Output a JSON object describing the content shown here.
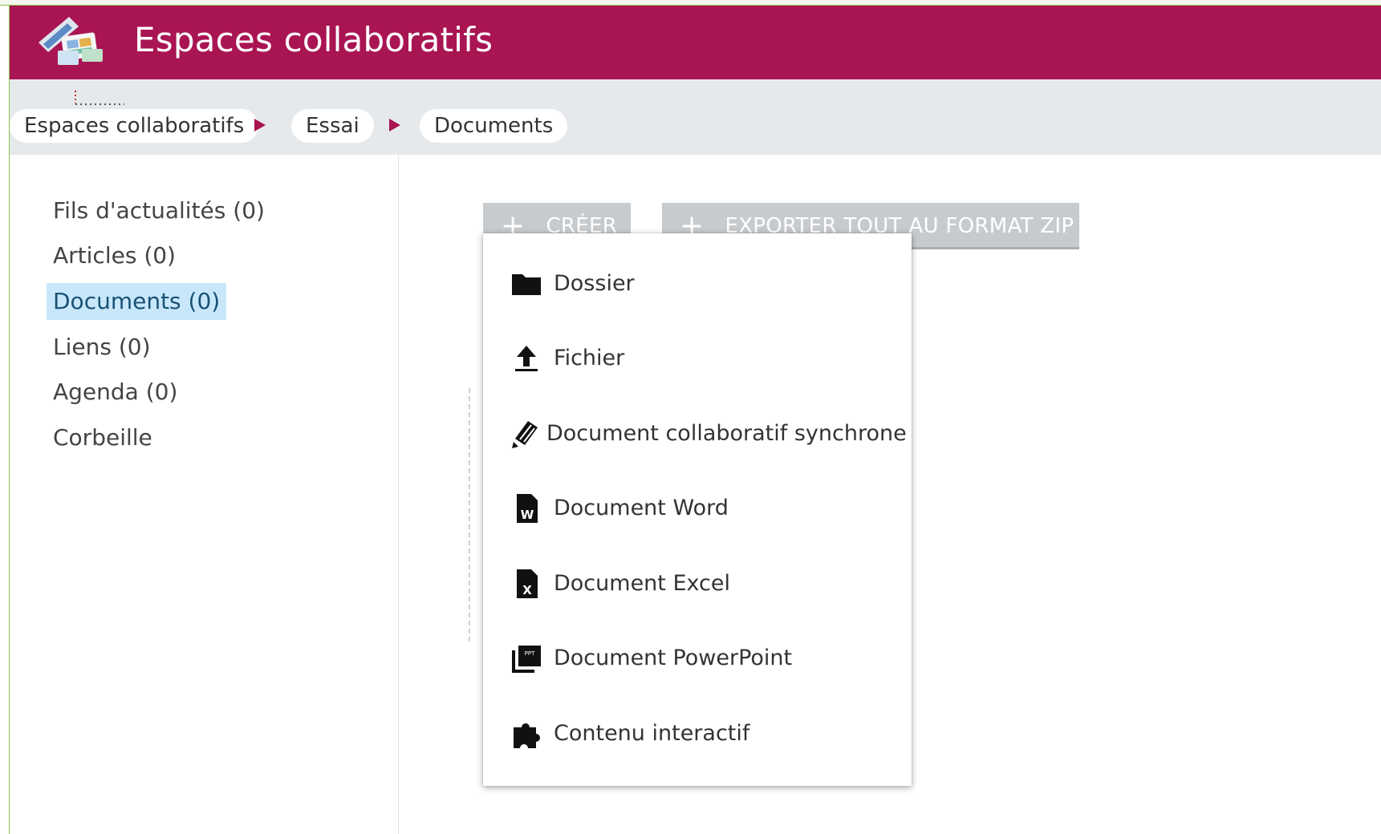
{
  "app": {
    "title": "Espaces collaboratifs",
    "brand_color": "#a91453"
  },
  "breadcrumb": [
    "Espaces collaboratifs",
    "Essai",
    "Documents"
  ],
  "sidebar": {
    "items": [
      {
        "label": "Fils d'actualités (0)",
        "active": false
      },
      {
        "label": "Articles (0)",
        "active": false
      },
      {
        "label": "Documents (0)",
        "active": true
      },
      {
        "label": "Liens (0)",
        "active": false
      },
      {
        "label": "Agenda (0)",
        "active": false
      },
      {
        "label": "Corbeille",
        "active": false
      }
    ]
  },
  "toolbar": {
    "create_label": "CRÉER",
    "export_label": "EXPORTER TOUT AU FORMAT ZIP"
  },
  "create_menu": {
    "items": [
      {
        "label": "Dossier",
        "icon": "folder-icon"
      },
      {
        "label": "Fichier",
        "icon": "upload-icon"
      },
      {
        "label": "Document collaboratif synchrone",
        "icon": "sync-doc-icon"
      },
      {
        "label": "Document Word",
        "icon": "word-doc-icon"
      },
      {
        "label": "Document Excel",
        "icon": "excel-doc-icon"
      },
      {
        "label": "Document PowerPoint",
        "icon": "powerpoint-doc-icon"
      },
      {
        "label": "Contenu interactif",
        "icon": "puzzle-icon"
      }
    ]
  }
}
